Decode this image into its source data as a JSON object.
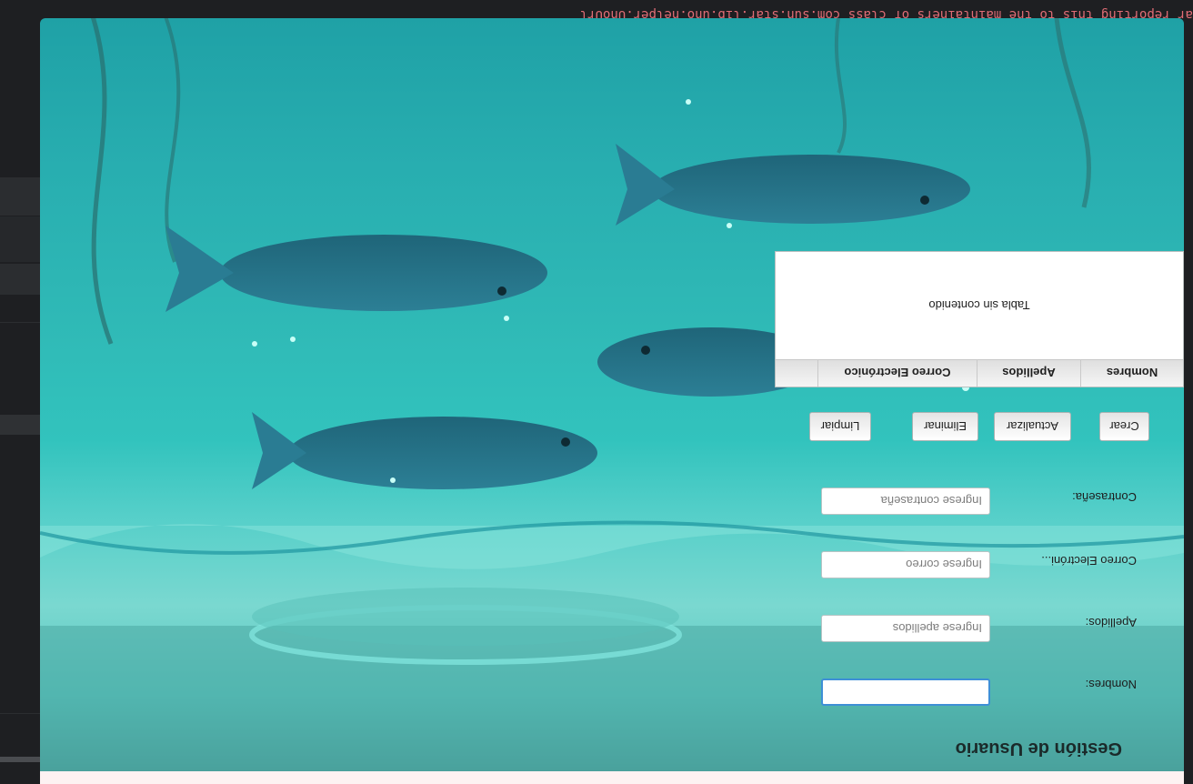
{
  "ide": {
    "error_line": "ar reporting this to the maintainers of class com.sun.star.lib.uno.helper.UnoUrl"
  },
  "app": {
    "form_title": "Gestión de Usuario",
    "labels": {
      "nombres": "Nombres:",
      "apellidos": "Apellidos:",
      "correo": "Correo Electróni...",
      "contrasena": "Contraseña:"
    },
    "inputs": {
      "nombres": {
        "value": "",
        "placeholder": ""
      },
      "apellidos": {
        "value": "",
        "placeholder": "Ingrese apellidos"
      },
      "correo": {
        "value": "",
        "placeholder": "Ingrese correo"
      },
      "contrasena": {
        "value": "",
        "placeholder": "Ingrese contraseña"
      }
    },
    "buttons": {
      "crear": "Crear",
      "actualizar": "Actualizar",
      "eliminar": "Eliminar",
      "limpiar": "Limpiar"
    },
    "table": {
      "columns": [
        "Nombres",
        "Apellidos",
        "Correo Electrónico",
        ""
      ],
      "empty_text": "Tabla sin contenido"
    }
  },
  "colors": {
    "water": "#32c3bd",
    "fish": "#2a7d93",
    "focus": "#3e8fd6"
  }
}
